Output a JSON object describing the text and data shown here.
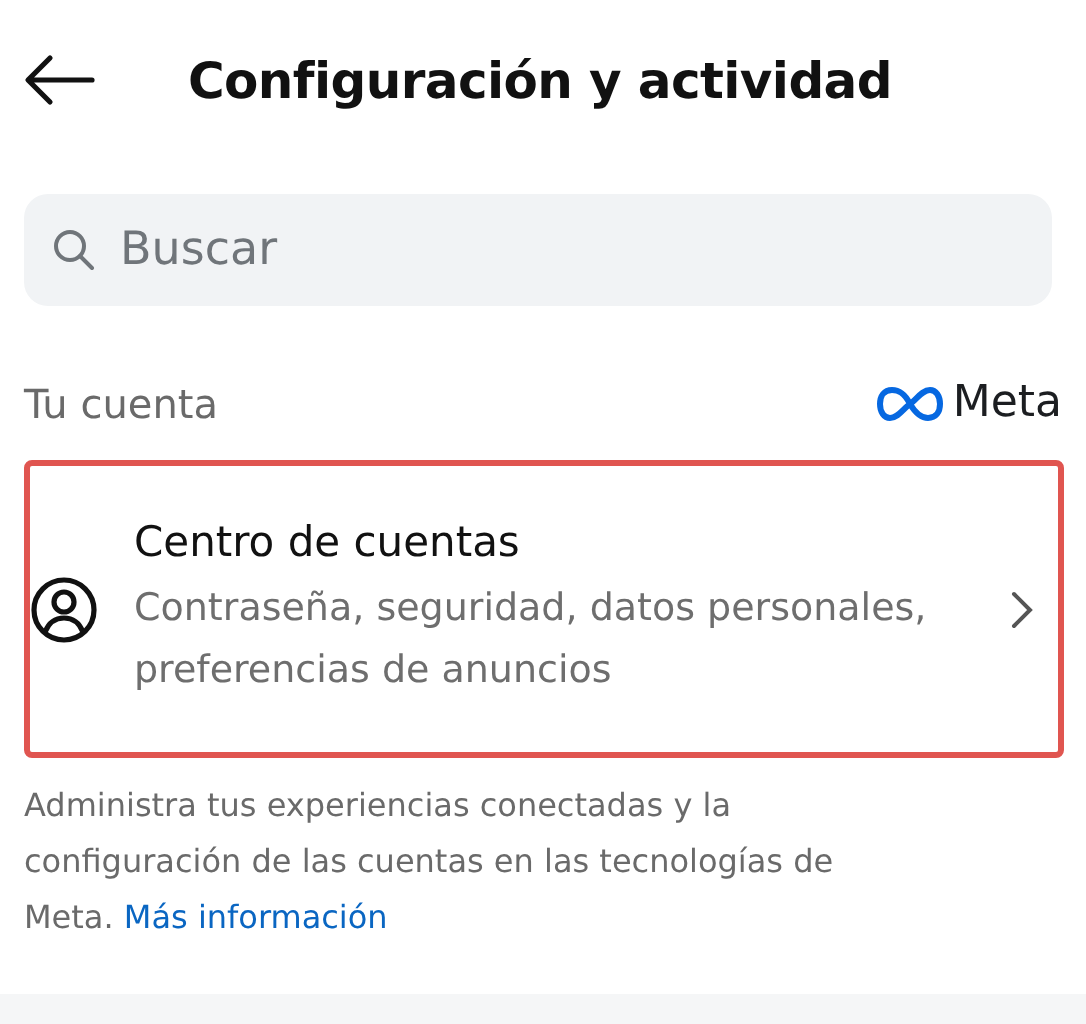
{
  "header": {
    "title": "Configuración y actividad"
  },
  "search": {
    "placeholder": "Buscar"
  },
  "section": {
    "title": "Tu cuenta",
    "brand": "Meta"
  },
  "account_center": {
    "title": "Centro de cuentas",
    "subtitle": "Contraseña, seguridad, datos personales, preferencias de anuncios",
    "highlighted": true
  },
  "description": {
    "text": "Administra tus experiencias conectadas y la configuración de las cuentas en las tecnologías de Meta.",
    "link": "Más información"
  }
}
